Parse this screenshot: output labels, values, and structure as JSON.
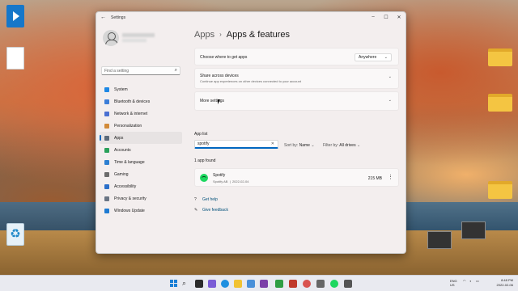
{
  "window": {
    "title": "Settings",
    "back_glyph": "←",
    "min_glyph": "–",
    "max_glyph": "☐",
    "close_glyph": "✕"
  },
  "sidebar": {
    "search_placeholder": "Find a setting",
    "items": [
      {
        "label": "System",
        "icon": "system-icon",
        "color": "#1e88e5"
      },
      {
        "label": "Bluetooth & devices",
        "icon": "bluetooth-icon",
        "color": "#3b7dd8"
      },
      {
        "label": "Network & internet",
        "icon": "network-icon",
        "color": "#4a6fd1"
      },
      {
        "label": "Personalization",
        "icon": "brush-icon",
        "color": "#d28a3a"
      },
      {
        "label": "Apps",
        "icon": "apps-icon",
        "color": "#5b6a7a",
        "active": true
      },
      {
        "label": "Accounts",
        "icon": "accounts-icon",
        "color": "#2aa15a"
      },
      {
        "label": "Time & language",
        "icon": "globe-clock-icon",
        "color": "#2c7fd1"
      },
      {
        "label": "Gaming",
        "icon": "gaming-icon",
        "color": "#6b6b6b"
      },
      {
        "label": "Accessibility",
        "icon": "accessibility-icon",
        "color": "#2b6fc9"
      },
      {
        "label": "Privacy & security",
        "icon": "shield-icon",
        "color": "#6a7584"
      },
      {
        "label": "Windows Update",
        "icon": "windows-update-icon",
        "color": "#1e7ad2"
      }
    ]
  },
  "header": {
    "parent": "Apps",
    "separator": "›",
    "current": "Apps & features"
  },
  "cards": {
    "choose": {
      "title": "Choose where to get apps",
      "value": "Anywhere"
    },
    "share": {
      "title": "Share across devices",
      "subtitle": "Continue app experiences on other devices connected to your account"
    },
    "more": {
      "title": "More settings"
    }
  },
  "applist": {
    "label": "App list",
    "search_value": "spotify",
    "sort_label": "Sort by:",
    "sort_value": "Name",
    "filter_label": "Filter by:",
    "filter_value": "All drives",
    "found_text": "1 app found",
    "apps": [
      {
        "name": "Spotify",
        "publisher": "Spotify AB",
        "date": "2022-02-04",
        "size": "215 MB",
        "icon_color": "#1ed760"
      }
    ]
  },
  "help": {
    "get_help": "Get help",
    "give_feedback": "Give feedback"
  },
  "taskbar": {
    "lang_line1": "ENG",
    "lang_line2": "US",
    "time": "8:48 PM",
    "date": "2022-02-06"
  }
}
